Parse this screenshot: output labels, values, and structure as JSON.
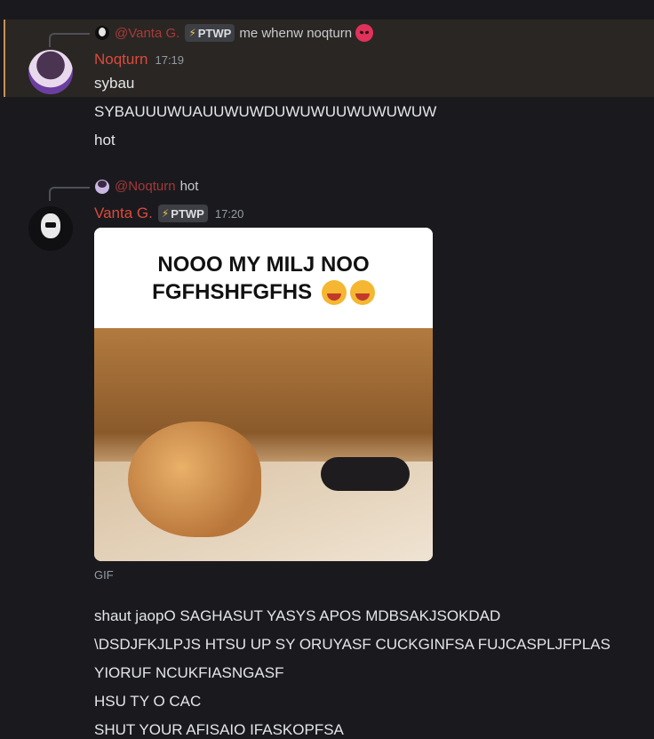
{
  "message1": {
    "reply": {
      "mention": "@Vanta G.",
      "tag": "PTWP",
      "text": "me whenw noqturn",
      "emoji": "angry-face"
    },
    "author": "Noqturn",
    "time": "17:19",
    "lines": [
      "sybau",
      "SYBAUUUWUAUUWUWDUWUWUUWUWUWUW",
      "hot"
    ]
  },
  "message2": {
    "reply": {
      "mention": "@Noqturn",
      "text": "hot"
    },
    "author": "Vanta G.",
    "tag": "PTWP",
    "time": "17:20",
    "gif": {
      "caption_line1": "NOOO MY MILJ NOO",
      "caption_line2": "FGFHSHFGFHS",
      "caption_emoji": "crying-face",
      "label": "GIF"
    },
    "lines": [
      "shaut jaopO SAGHASUT YASYS APOS MDBSAKJSOKDAD",
      "\\DSDJFKJLPJS HTSU UP SY ORUYASF CUCKGINFSA FUJCASPLJFPLAS",
      "YIORUF NCUKFIASNGASF",
      "HSU TY O CAC",
      "SHUT YOUR AFISAIO IFASKOPFSA"
    ]
  },
  "colors": {
    "background": "#1a1a1e",
    "highlight": "#2a2623",
    "highlight_border": "#c8915b",
    "username": "#d94b3c",
    "mention": "#d04340",
    "timestamp": "#949ba4"
  }
}
